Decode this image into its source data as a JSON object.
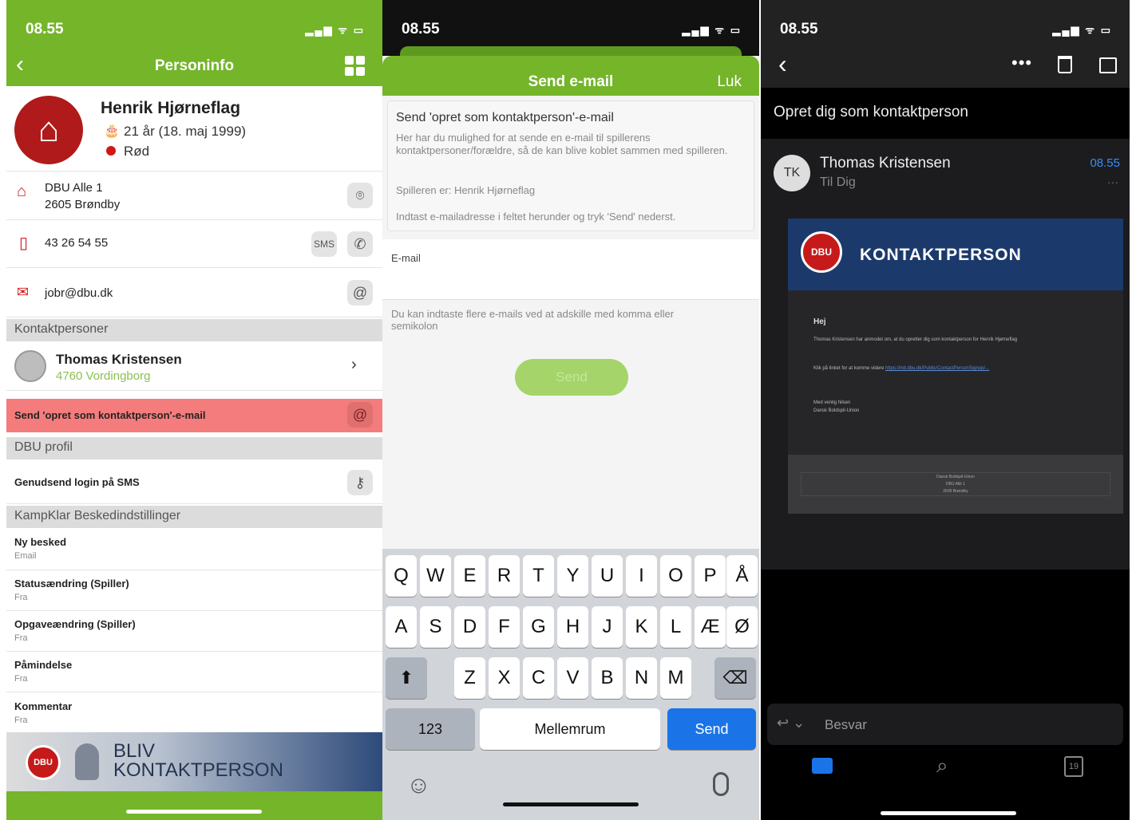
{
  "status_bar": {
    "time": "08.55",
    "icons": "▂▄▆ ᯤ ▭"
  },
  "personinfo": {
    "title": "Personinfo",
    "name": "Henrik Hjørneflag",
    "age": "21 år (18. maj 1999)",
    "color": "Rød",
    "address_line1": "DBU Alle 1",
    "address_line2": "2605 Brøndby",
    "phone": "43 26 54 55",
    "email": "jobr@dbu.dk",
    "section_contacts": "Kontaktpersoner",
    "contact_name": "Thomas Kristensen",
    "contact_city": "4760 Vordingborg",
    "send_opret": "Send 'opret som kontaktperson'-e-mail",
    "section_dbu": "DBU profil",
    "resend_sms": "Genudsend login på SMS",
    "section_kampklar": "KampKlar Beskedindstillinger",
    "settings": [
      {
        "label": "Ny besked",
        "value": "Email"
      },
      {
        "label": "Statusændring (Spiller)",
        "value": "Fra"
      },
      {
        "label": "Opgaveændring (Spiller)",
        "value": "Fra"
      },
      {
        "label": "Påmindelse",
        "value": "Fra"
      },
      {
        "label": "Kommentar",
        "value": "Fra"
      }
    ],
    "banner_line1": "BLIV",
    "banner_line2": "KONTAKTPERSON",
    "dbu_logo": "DBU"
  },
  "send_email": {
    "title": "Send e-mail",
    "close": "Luk",
    "heading": "Send 'opret som kontaktperson'-e-mail",
    "desc": "Her har du mulighed for at sende en e-mail til spillerens kontaktpersoner/forældre, så de kan blive koblet sammen med spilleren.",
    "player": "Spilleren er: Henrik Hjørneflag",
    "instruction": "Indtast e-mailadresse i feltet herunder og tryk 'Send' nederst.",
    "email_label": "E-mail",
    "email_value": "",
    "hint": "Du kan indtaste flere e-mails ved at adskille med komma eller semikolon",
    "send_button": "Send"
  },
  "keyboard": {
    "row1": [
      "Q",
      "W",
      "E",
      "R",
      "T",
      "Y",
      "U",
      "I",
      "O",
      "P",
      "Å"
    ],
    "row2": [
      "A",
      "S",
      "D",
      "F",
      "G",
      "H",
      "J",
      "K",
      "L",
      "Æ",
      "Ø"
    ],
    "row3": [
      "Z",
      "X",
      "C",
      "V",
      "B",
      "N",
      "M"
    ],
    "numbers": "123",
    "space": "Mellemrum",
    "send": "Send"
  },
  "mail": {
    "subject": "Opret dig som kontaktperson",
    "sender_initials": "TK",
    "sender": "Thomas Kristensen",
    "to": "Til Dig",
    "time": "08.55",
    "banner_title": "KONTAKTPERSON",
    "greeting": "Hej",
    "body1": "Thomas Kristensen har anmodet om, at du opretter dig som kontaktperson for Henrik Hjørneflag",
    "body2_prefix": "Klik på linket for at komme videre",
    "link": "https://intl.dbu.dk/Public/ContactPersonSignup/...",
    "signoff1": "Med venlig hilsen",
    "signoff2": "Dansk Boldspil-Union",
    "footer1": "Dansk Boldspil-Union",
    "footer2": "DBU Allé 1",
    "footer3": "2605 Brøndby",
    "reply": "Besvar",
    "calendar_day": "19"
  },
  "colors": {
    "green": "#74b52a",
    "red": "#c61a1a",
    "blue": "#1a74e8",
    "navy": "#1b3a6b"
  }
}
